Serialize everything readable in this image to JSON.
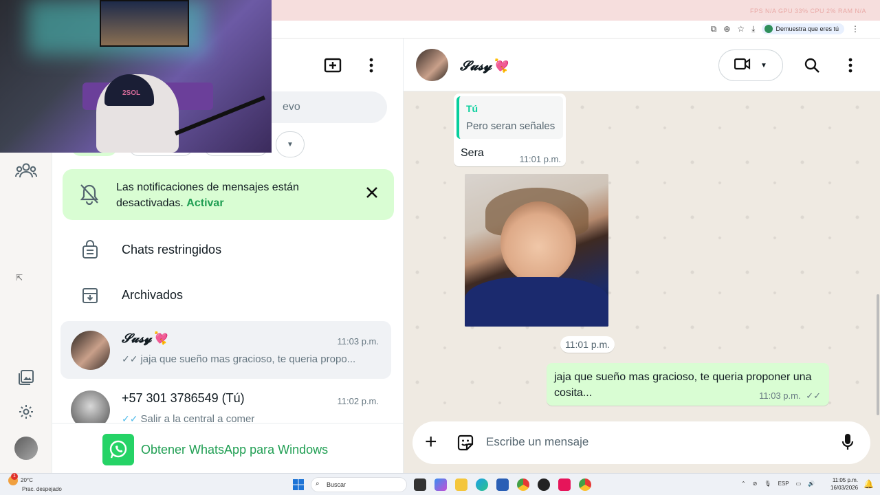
{
  "browser": {
    "stats_text": "FPS N/A   GPU 33%   CPU 2%   RAM N/A",
    "verify_button": "Demuestra que eres tú"
  },
  "sidebar": {
    "search_placeholder_visible": "evo"
  },
  "notification": {
    "text": "Las notificaciones de mensajes están desactivadas.",
    "action": "Activar"
  },
  "list": {
    "restricted": "Chats restringidos",
    "archived": "Archivados",
    "chats": [
      {
        "name": "𝓢𝓾𝓼𝔂💘",
        "time": "11:03 p.m.",
        "preview": "jaja que sueño mas gracioso, te queria propo...",
        "ticks": "✓✓",
        "read": false
      },
      {
        "name": "+57 301 3786549 (Tú)",
        "time": "11:02 p.m.",
        "preview": "Salir a la central a comer",
        "ticks": "✓✓",
        "read": true
      }
    ],
    "get_app": "Obtener WhatsApp para Windows"
  },
  "conversation": {
    "contact_name": "𝓢𝓾𝓼𝔂💘",
    "messages": {
      "quoted_author": "Tú",
      "quoted_text": "Pero seran señales",
      "reply_text": "Sera",
      "reply_time": "11:01 p.m.",
      "day_chip": "11:01 p.m.",
      "outgoing_text": "jaja que sueño mas gracioso, te queria proponer una cosita...",
      "outgoing_time": "11:03 p.m.",
      "outgoing_ticks": "✓✓"
    },
    "composer_placeholder": "Escribe un mensaje"
  },
  "taskbar": {
    "temp": "20°C",
    "weather": "Prac. despejado",
    "search": "Buscar",
    "lang": "ESP",
    "time": "11:05 p.m.",
    "date": "16/03/2026",
    "weather_badge": "1"
  },
  "colors": {
    "accent_green": "#1f9e52",
    "bubble_out": "#d9fdd3",
    "chat_bg": "#efeae2"
  }
}
